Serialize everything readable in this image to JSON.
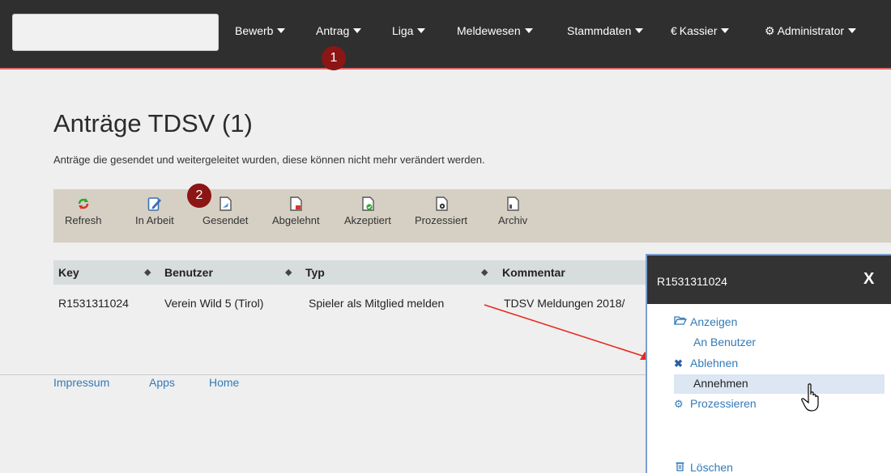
{
  "nav": {
    "items": [
      {
        "label": "Bewerb",
        "icon": ""
      },
      {
        "label": "Antrag",
        "icon": ""
      },
      {
        "label": "Liga",
        "icon": ""
      },
      {
        "label": "Meldewesen",
        "icon": ""
      },
      {
        "label": "Stammdaten",
        "icon": ""
      },
      {
        "label": "Kassier",
        "icon": "€"
      },
      {
        "label": "Administrator",
        "icon": "⚙"
      }
    ]
  },
  "badges": [
    "1",
    "2"
  ],
  "page": {
    "title": "Anträge TDSV (1)",
    "description": "Anträge die gesendet und weitergeleitet wurden, diese können nicht mehr verändert werden."
  },
  "toolbar": [
    {
      "label": "Refresh",
      "icon": "refresh-icon"
    },
    {
      "label": "In Arbeit",
      "icon": "edit-icon"
    },
    {
      "label": "Gesendet",
      "icon": "sent-document-icon"
    },
    {
      "label": "Abgelehnt",
      "icon": "rejected-document-icon"
    },
    {
      "label": "Akzeptiert",
      "icon": "accepted-document-icon"
    },
    {
      "label": "Prozessiert",
      "icon": "processed-document-icon"
    },
    {
      "label": "Archiv",
      "icon": "archive-document-icon"
    }
  ],
  "table": {
    "columns": [
      "Key",
      "Benutzer",
      "Typ",
      "Kommentar"
    ],
    "rows": [
      [
        "R1531311024",
        "Verein Wild 5 (Tirol)",
        "Spieler als Mitglied melden",
        "TDSV Meldungen 2018/"
      ]
    ]
  },
  "footer": {
    "links": [
      "Impressum",
      "Apps",
      "Home"
    ]
  },
  "panel": {
    "title": "R1531311024",
    "close": "X",
    "menu": [
      {
        "label": "Anzeigen",
        "icon": "folder-open-icon"
      },
      {
        "label": "An Benutzer",
        "icon": ""
      },
      {
        "label": "Ablehnen",
        "icon": "close-icon"
      },
      {
        "label": "Annehmen",
        "icon": ""
      },
      {
        "label": "Prozessieren",
        "icon": "gears-icon"
      },
      {
        "label": "Löschen",
        "icon": "trash-icon"
      }
    ]
  },
  "colors": {
    "navbar": "#2f2f2f",
    "accent_line": "#e06a6a",
    "badge": "#8c1515",
    "toolbar": "#d6d0c4",
    "link": "#337ab7",
    "highlight": "#dde6f3",
    "arrow": "#e8281e"
  }
}
